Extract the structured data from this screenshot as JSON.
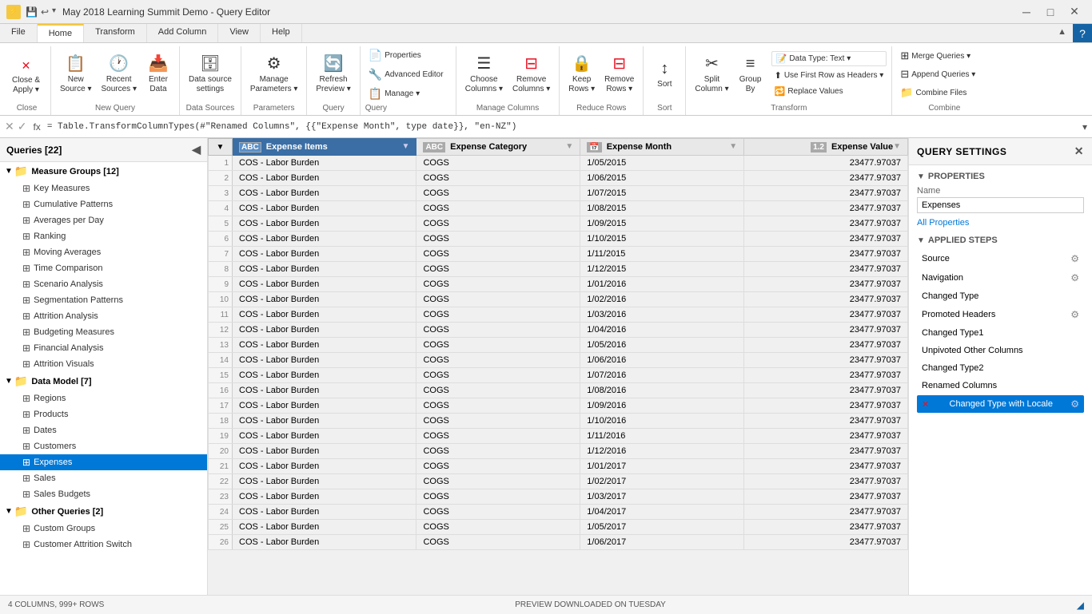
{
  "titleBar": {
    "title": "May 2018 Learning Summit Demo - Query Editor",
    "appIcon": "PBI"
  },
  "ribbonTabs": [
    {
      "label": "File",
      "active": false
    },
    {
      "label": "Home",
      "active": true
    },
    {
      "label": "Transform",
      "active": false
    },
    {
      "label": "Add Column",
      "active": false
    },
    {
      "label": "View",
      "active": false
    },
    {
      "label": "Help",
      "active": false
    }
  ],
  "ribbonGroups": {
    "close": {
      "label": "Close",
      "buttons": [
        {
          "icon": "✕",
          "text": "Close &\nApply ▾"
        }
      ]
    },
    "newQuery": {
      "label": "New Query",
      "buttons": [
        {
          "icon": "📋",
          "text": "New\nSource ▾"
        },
        {
          "icon": "📁",
          "text": "Recent\nSources ▾"
        },
        {
          "icon": "📥",
          "text": "Enter\nData"
        }
      ]
    },
    "dataSources": {
      "label": "Data Sources",
      "buttons": [
        {
          "icon": "🔧",
          "text": "Data source\nsettings"
        }
      ]
    },
    "parameters": {
      "label": "Parameters",
      "buttons": [
        {
          "icon": "⚙",
          "text": "Manage\nParameters ▾"
        }
      ]
    },
    "query": {
      "label": "Query",
      "buttons": [
        {
          "icon": "🔄",
          "text": "Refresh\nPreview ▾"
        }
      ]
    },
    "manageColumns": {
      "label": "Manage Columns",
      "buttons": [
        {
          "icon": "☰",
          "text": "Choose\nColumns ▾"
        },
        {
          "icon": "✕",
          "text": "Remove\nColumns ▾"
        }
      ]
    },
    "reduceRows": {
      "label": "Reduce Rows",
      "buttons": [
        {
          "icon": "🔒",
          "text": "Keep\nRows ▾"
        },
        {
          "icon": "✕",
          "text": "Remove\nRows ▾"
        }
      ]
    },
    "sort": {
      "label": "Sort",
      "buttons": [
        {
          "icon": "↑↓",
          "text": ""
        },
        {
          "icon": "↑↓",
          "text": "Sort"
        }
      ]
    },
    "transform": {
      "label": "Transform",
      "rightItems": [
        {
          "text": "Data Type: Text ▾"
        },
        {
          "text": "Use First Row as Headers ▾"
        },
        {
          "text": "Replace Values"
        }
      ],
      "buttons": [
        {
          "icon": "✂",
          "text": "Split\nColumn ▾"
        },
        {
          "icon": "≡",
          "text": "Group\nBy"
        }
      ]
    },
    "combine": {
      "label": "Combine",
      "items": [
        {
          "text": "Merge Queries ▾"
        },
        {
          "text": "Append Queries ▾"
        },
        {
          "text": "Combine Files"
        }
      ]
    }
  },
  "formulaBar": {
    "formula": "= Table.TransformColumnTypes(#\"Renamed Columns\", {{\"Expense Month\", type date}}, \"en-NZ\")"
  },
  "sidebar": {
    "title": "Queries [22]",
    "groups": [
      {
        "name": "Measure Groups [12]",
        "expanded": true,
        "items": [
          "Key Measures",
          "Cumulative Patterns",
          "Averages per Day",
          "Ranking",
          "Moving Averages",
          "Time Comparison",
          "Scenario Analysis",
          "Segmentation Patterns",
          "Attrition Analysis",
          "Budgeting Measures",
          "Financial Analysis",
          "Attrition Visuals"
        ]
      },
      {
        "name": "Data Model [7]",
        "expanded": true,
        "items": [
          "Regions",
          "Products",
          "Dates",
          "Customers",
          "Expenses",
          "Sales",
          "Sales Budgets"
        ]
      },
      {
        "name": "Other Queries [2]",
        "expanded": true,
        "items": [
          "Custom Groups",
          "Customer Attrition Switch"
        ]
      }
    ],
    "activeItem": "Expenses"
  },
  "table": {
    "columns": [
      {
        "name": "Expense Items",
        "type": "ABC",
        "typeIcon": "🔡"
      },
      {
        "name": "Expense Category",
        "type": "ABC",
        "typeIcon": "🔡"
      },
      {
        "name": "Expense Month",
        "type": "📅",
        "typeIcon": "📅"
      },
      {
        "name": "Expense Value",
        "type": "1.2",
        "typeIcon": "1.2"
      }
    ],
    "rows": [
      [
        "COS - Labor Burden",
        "COGS",
        "1/05/2015",
        "23477.97037"
      ],
      [
        "COS - Labor Burden",
        "COGS",
        "1/06/2015",
        "23477.97037"
      ],
      [
        "COS - Labor Burden",
        "COGS",
        "1/07/2015",
        "23477.97037"
      ],
      [
        "COS - Labor Burden",
        "COGS",
        "1/08/2015",
        "23477.97037"
      ],
      [
        "COS - Labor Burden",
        "COGS",
        "1/09/2015",
        "23477.97037"
      ],
      [
        "COS - Labor Burden",
        "COGS",
        "1/10/2015",
        "23477.97037"
      ],
      [
        "COS - Labor Burden",
        "COGS",
        "1/11/2015",
        "23477.97037"
      ],
      [
        "COS - Labor Burden",
        "COGS",
        "1/12/2015",
        "23477.97037"
      ],
      [
        "COS - Labor Burden",
        "COGS",
        "1/01/2016",
        "23477.97037"
      ],
      [
        "COS - Labor Burden",
        "COGS",
        "1/02/2016",
        "23477.97037"
      ],
      [
        "COS - Labor Burden",
        "COGS",
        "1/03/2016",
        "23477.97037"
      ],
      [
        "COS - Labor Burden",
        "COGS",
        "1/04/2016",
        "23477.97037"
      ],
      [
        "COS - Labor Burden",
        "COGS",
        "1/05/2016",
        "23477.97037"
      ],
      [
        "COS - Labor Burden",
        "COGS",
        "1/06/2016",
        "23477.97037"
      ],
      [
        "COS - Labor Burden",
        "COGS",
        "1/07/2016",
        "23477.97037"
      ],
      [
        "COS - Labor Burden",
        "COGS",
        "1/08/2016",
        "23477.97037"
      ],
      [
        "COS - Labor Burden",
        "COGS",
        "1/09/2016",
        "23477.97037"
      ],
      [
        "COS - Labor Burden",
        "COGS",
        "1/10/2016",
        "23477.97037"
      ],
      [
        "COS - Labor Burden",
        "COGS",
        "1/11/2016",
        "23477.97037"
      ],
      [
        "COS - Labor Burden",
        "COGS",
        "1/12/2016",
        "23477.97037"
      ],
      [
        "COS - Labor Burden",
        "COGS",
        "1/01/2017",
        "23477.97037"
      ],
      [
        "COS - Labor Burden",
        "COGS",
        "1/02/2017",
        "23477.97037"
      ],
      [
        "COS - Labor Burden",
        "COGS",
        "1/03/2017",
        "23477.97037"
      ],
      [
        "COS - Labor Burden",
        "COGS",
        "1/04/2017",
        "23477.97037"
      ],
      [
        "COS - Labor Burden",
        "COGS",
        "1/05/2017",
        "23477.97037"
      ],
      [
        "COS - Labor Burden",
        "COGS",
        "1/06/2017",
        "23477.97037"
      ]
    ]
  },
  "querySettings": {
    "title": "QUERY SETTINGS",
    "properties": {
      "sectionTitle": "PROPERTIES",
      "nameLabel": "Name",
      "nameValue": "Expenses",
      "allPropertiesLink": "All Properties"
    },
    "appliedSteps": {
      "sectionTitle": "APPLIED STEPS",
      "steps": [
        {
          "name": "Source",
          "hasGear": true,
          "active": false,
          "error": false
        },
        {
          "name": "Navigation",
          "hasGear": true,
          "active": false,
          "error": false
        },
        {
          "name": "Changed Type",
          "hasGear": false,
          "active": false,
          "error": false
        },
        {
          "name": "Promoted Headers",
          "hasGear": true,
          "active": false,
          "error": false
        },
        {
          "name": "Changed Type1",
          "hasGear": false,
          "active": false,
          "error": false
        },
        {
          "name": "Unpivoted Other Columns",
          "hasGear": false,
          "active": false,
          "error": false
        },
        {
          "name": "Changed Type2",
          "hasGear": false,
          "active": false,
          "error": false
        },
        {
          "name": "Renamed Columns",
          "hasGear": false,
          "active": false,
          "error": false
        },
        {
          "name": "Changed Type with Locale",
          "hasGear": true,
          "active": true,
          "error": true
        }
      ]
    }
  },
  "statusBar": {
    "left": "4 COLUMNS, 999+ ROWS",
    "right": "PREVIEW DOWNLOADED ON TUESDAY"
  }
}
